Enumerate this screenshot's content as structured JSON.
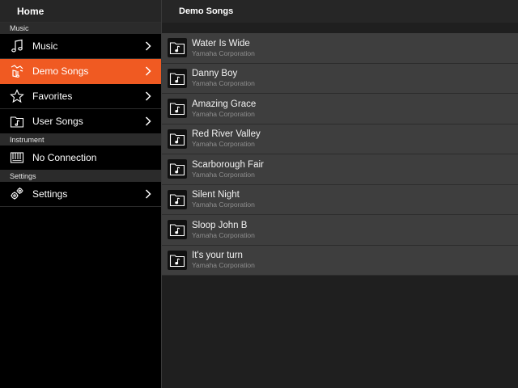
{
  "sidebar": {
    "header": "Home",
    "sections": [
      {
        "label": "Music",
        "items": [
          {
            "label": "Music",
            "icon": "music-note-icon",
            "chevron": true,
            "active": false
          },
          {
            "label": "Demo Songs",
            "icon": "demo-songs-icon",
            "chevron": true,
            "active": true
          },
          {
            "label": "Favorites",
            "icon": "star-icon",
            "chevron": true,
            "active": false
          },
          {
            "label": "User Songs",
            "icon": "user-songs-folder-icon",
            "chevron": true,
            "active": false
          }
        ]
      },
      {
        "label": "Instrument",
        "items": [
          {
            "label": "No Connection",
            "icon": "keyboard-icon",
            "chevron": false,
            "active": false
          }
        ]
      },
      {
        "label": "Settings",
        "items": [
          {
            "label": "Settings",
            "icon": "gears-icon",
            "chevron": true,
            "active": false
          }
        ]
      }
    ]
  },
  "main": {
    "title": "Demo Songs",
    "songs": [
      {
        "title": "Water Is Wide",
        "artist": "Yamaha Corporation"
      },
      {
        "title": "Danny Boy",
        "artist": "Yamaha Corporation"
      },
      {
        "title": "Amazing Grace",
        "artist": "Yamaha Corporation"
      },
      {
        "title": "Red River Valley",
        "artist": "Yamaha Corporation"
      },
      {
        "title": "Scarborough Fair",
        "artist": "Yamaha Corporation"
      },
      {
        "title": "Silent Night",
        "artist": "Yamaha Corporation"
      },
      {
        "title": "Sloop John B",
        "artist": "Yamaha Corporation"
      },
      {
        "title": "It's your turn",
        "artist": "Yamaha Corporation"
      }
    ]
  },
  "colors": {
    "accent": "#f05a22",
    "row": "#3e3e3e",
    "sidebar": "#000000"
  }
}
